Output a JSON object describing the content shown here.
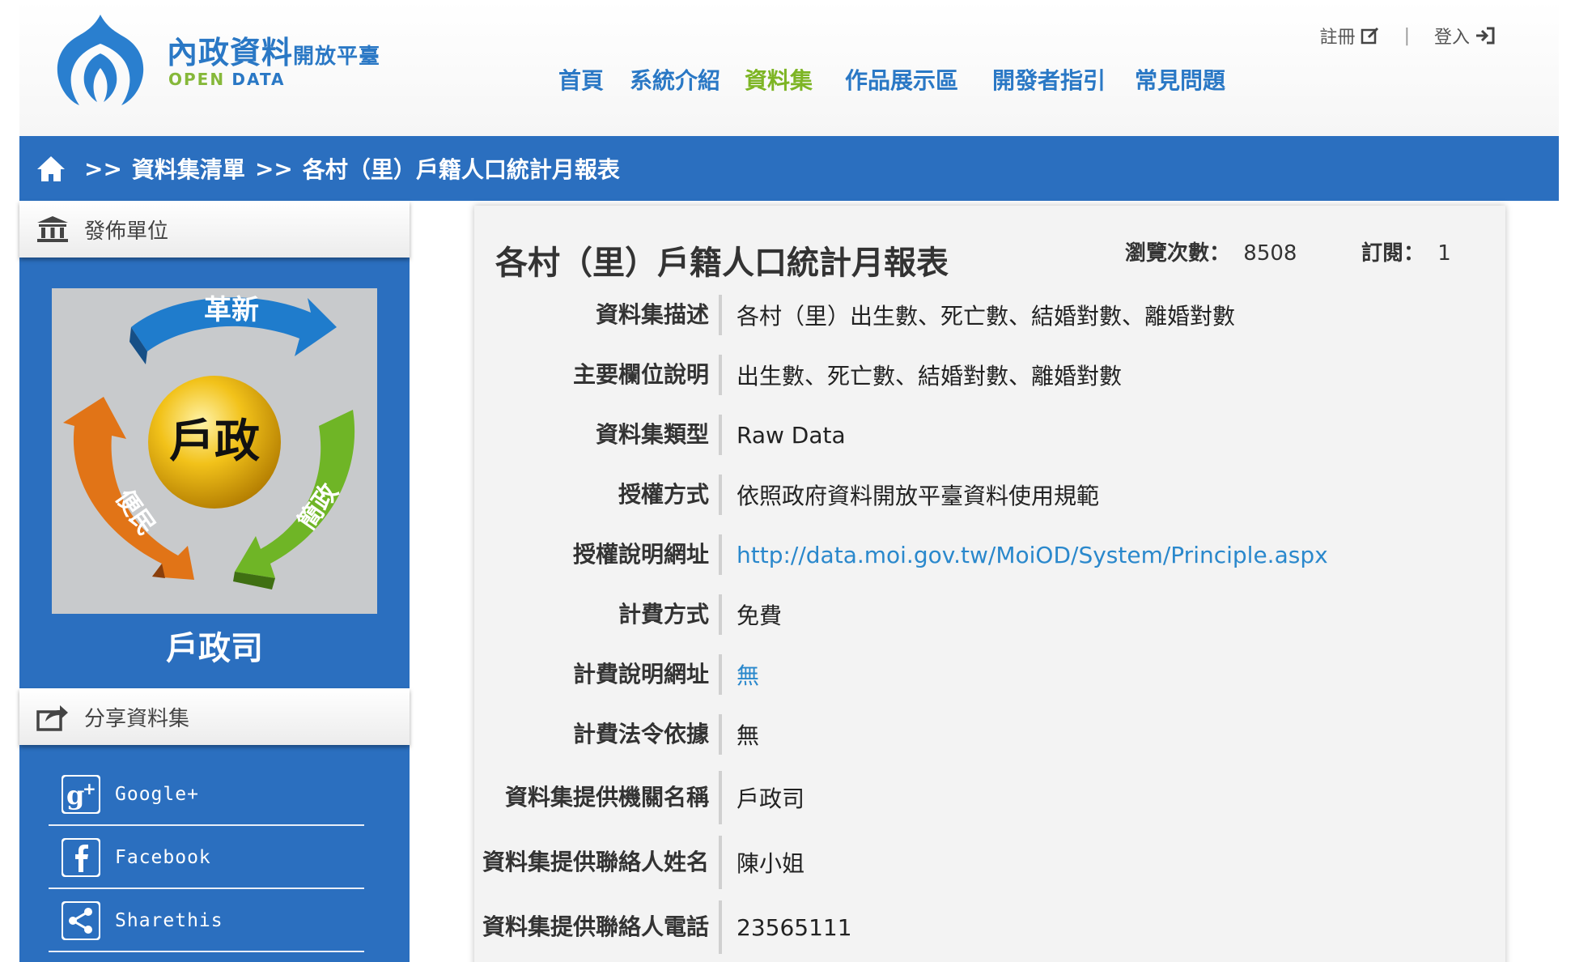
{
  "site": {
    "title_main": "內政資料",
    "title_small": "開放平臺",
    "subtitle_open": "OPEN",
    "subtitle_data": "DATA",
    "register_label": "註冊",
    "separator": "|",
    "login_label": "登入"
  },
  "nav": {
    "home": "首頁",
    "intro": "系統介紹",
    "datasets": "資料集",
    "showcase": "作品展示區",
    "developer": "開發者指引",
    "faq": "常見問題"
  },
  "breadcrumb": {
    "sep1": ">>",
    "list": "資料集清單",
    "sep2": ">>",
    "current": "各村（里）戶籍人口統計月報表"
  },
  "sidebar": {
    "publisher_heading": "發佈單位",
    "emblem_center": "戶政",
    "emblem_top": "革新",
    "emblem_left": "便民",
    "emblem_right": "簡政",
    "unit_name": "戶政司",
    "share_heading": "分享資料集",
    "share": {
      "google": "Google+",
      "facebook": "Facebook",
      "sharethis": "Sharethis"
    }
  },
  "dataset": {
    "title": "各村（里）戶籍人口統計月報表",
    "views_label": "瀏覽次數：",
    "views_value": "8508",
    "subs_label": "訂閱：",
    "subs_value": "1",
    "fields": [
      {
        "label": "資料集描述",
        "value": "各村（里）出生數、死亡數、結婚對數、離婚對數"
      },
      {
        "label": "主要欄位說明",
        "value": "出生數、死亡數、結婚對數、離婚對數"
      },
      {
        "label": "資料集類型",
        "value": "Raw Data"
      },
      {
        "label": "授權方式",
        "value": "依照政府資料開放平臺資料使用規範"
      },
      {
        "label": "授權說明網址",
        "value": "http://data.moi.gov.tw/MoiOD/System/Principle.aspx"
      },
      {
        "label": "計費方式",
        "value": "免費"
      },
      {
        "label": "計費說明網址",
        "value": "無"
      },
      {
        "label": "計費法令依據",
        "value": "無"
      },
      {
        "label": "資料集提供機關名稱",
        "value": "戶政司"
      },
      {
        "label": "資料集提供聯絡人姓名",
        "value": "陳小姐"
      },
      {
        "label": "資料集提供聯絡人電話",
        "value": "23565111"
      }
    ]
  },
  "colors": {
    "brand_blue": "#2b6fbf",
    "nav_blue": "#2a78c5",
    "nav_active_green": "#7db524",
    "link_blue": "#2a88cc"
  }
}
